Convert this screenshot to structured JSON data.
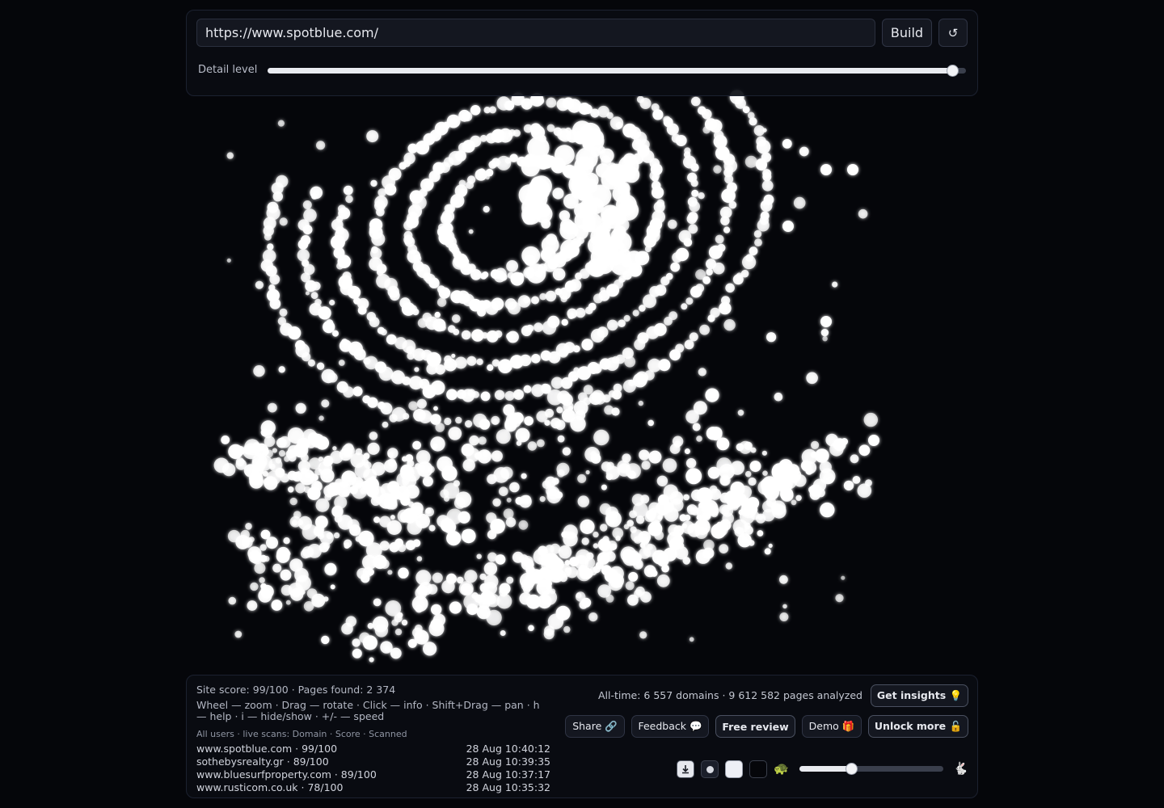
{
  "top": {
    "url_value": "https://www.spotblue.com/",
    "url_placeholder": "",
    "build_label": "Build",
    "reset_symbol": "↺",
    "detail_label": "Detail level",
    "detail_level_fraction": 0.98
  },
  "visualization": {
    "background": "#05060a",
    "dot_color": "#ffffff"
  },
  "bottom": {
    "stats": "Site score: 99/100 · Pages found: 2 374",
    "help": "Wheel — zoom · Drag — rotate · Click — info · Shift+Drag — pan · h — help · i — hide/show · +/- — speed",
    "scans_header": "All users · live scans: Domain · Score · Scanned",
    "scans": [
      {
        "domain": "www.spotblue.com · 99/100",
        "time": "28 Aug 10:40:12"
      },
      {
        "domain": "sothebysrealty.gr · 89/100",
        "time": "28 Aug 10:39:35"
      },
      {
        "domain": "www.bluesurfproperty.com · 89/100",
        "time": "28 Aug 10:37:17"
      },
      {
        "domain": "www.rusticom.co.uk · 78/100",
        "time": "28 Aug 10:35:32"
      }
    ],
    "alltime": "All-time: 6 557 domains · 9 612 582 pages analyzed",
    "buttons": {
      "insights": "Get insights 💡",
      "share": "Share 🔗",
      "feedback": "Feedback 💬",
      "review": "Free review",
      "demo": "Demo 🎁",
      "unlock": "Unlock more 🔓"
    },
    "speed_fraction": 0.36,
    "icons": {
      "download": "download-icon",
      "turtle": "🐢",
      "rabbit": "🐇"
    }
  }
}
